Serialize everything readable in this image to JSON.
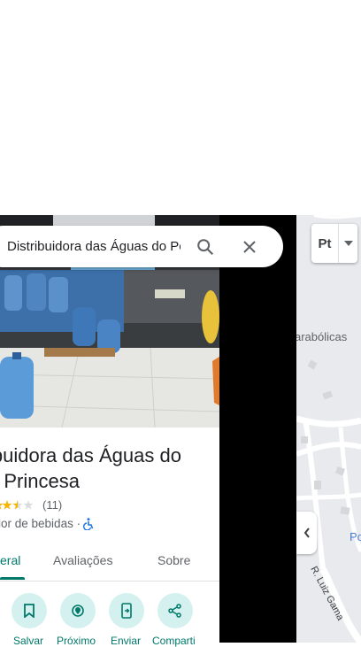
{
  "search": {
    "query": "Distribuidora das Águas do Po"
  },
  "place": {
    "title_line1": "ibuidora das Águas do",
    "title_line2": "o Princesa",
    "review_count": "(11)",
    "rating": 3.5,
    "category": "edor de bebidas · ",
    "accessibility_icon": "wheelchair-icon"
  },
  "tabs": [
    {
      "label": "eral",
      "active": true
    },
    {
      "label": "Avaliações",
      "active": false
    },
    {
      "label": "Sobre",
      "active": false
    }
  ],
  "actions": [
    {
      "label": "Salvar",
      "icon": "bookmark-icon"
    },
    {
      "label": "Próximo",
      "icon": "nearby-icon"
    },
    {
      "label": "Enviar",
      "icon": "send-to-phone-icon"
    },
    {
      "label": "Comparti",
      "icon": "share-icon"
    }
  ],
  "map": {
    "label_parabolicas": "arabólicas",
    "label_po": "Po",
    "street": "R. Luiz Gama"
  },
  "language_control": {
    "label": "Pt"
  },
  "colors": {
    "accent": "#00796b",
    "action_bg": "#d4f1f0",
    "map_bg": "#e8eaed"
  }
}
